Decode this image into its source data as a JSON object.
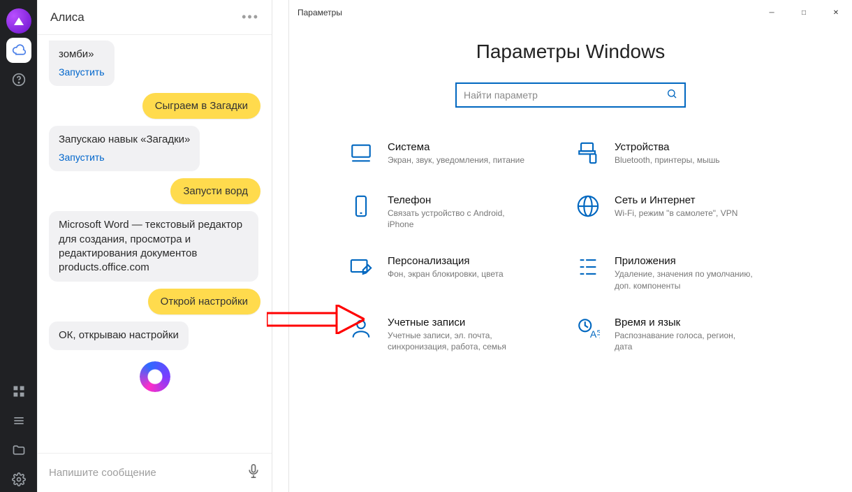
{
  "chat": {
    "title": "Алиса",
    "bot_msg1_line1": "зомби»",
    "run_label": "Запустить",
    "user_msg1": "Сыграем в Загадки",
    "bot_msg2": "Запускаю навык «Загадки»",
    "user_msg2": "Запусти ворд",
    "bot_msg3": "Microsoft Word — текстовый редактор для создания, просмотра и редактирования документов products.office.com",
    "user_msg3": "Открой настройки",
    "bot_msg4": "ОК, открываю настройки",
    "input_placeholder": "Напишите сообщение"
  },
  "settings": {
    "window_title": "Параметры",
    "heading": "Параметры Windows",
    "search_placeholder": "Найти параметр",
    "tiles": {
      "system": {
        "title": "Система",
        "desc": "Экран, звук, уведомления, питание"
      },
      "devices": {
        "title": "Устройства",
        "desc": "Bluetooth, принтеры, мышь"
      },
      "phone": {
        "title": "Телефон",
        "desc": "Связать устройство с Android, iPhone"
      },
      "network": {
        "title": "Сеть и Интернет",
        "desc": "Wi-Fi, режим \"в самолете\", VPN"
      },
      "personalization": {
        "title": "Персонализация",
        "desc": "Фон, экран блокировки, цвета"
      },
      "apps": {
        "title": "Приложения",
        "desc": "Удаление, значения по умолчанию, доп. компоненты"
      },
      "accounts": {
        "title": "Учетные записи",
        "desc": "Учетные записи, эл. почта, синхронизация, работа, семья"
      },
      "time": {
        "title": "Время и язык",
        "desc": "Распознавание голоса, регион, дата"
      }
    }
  }
}
